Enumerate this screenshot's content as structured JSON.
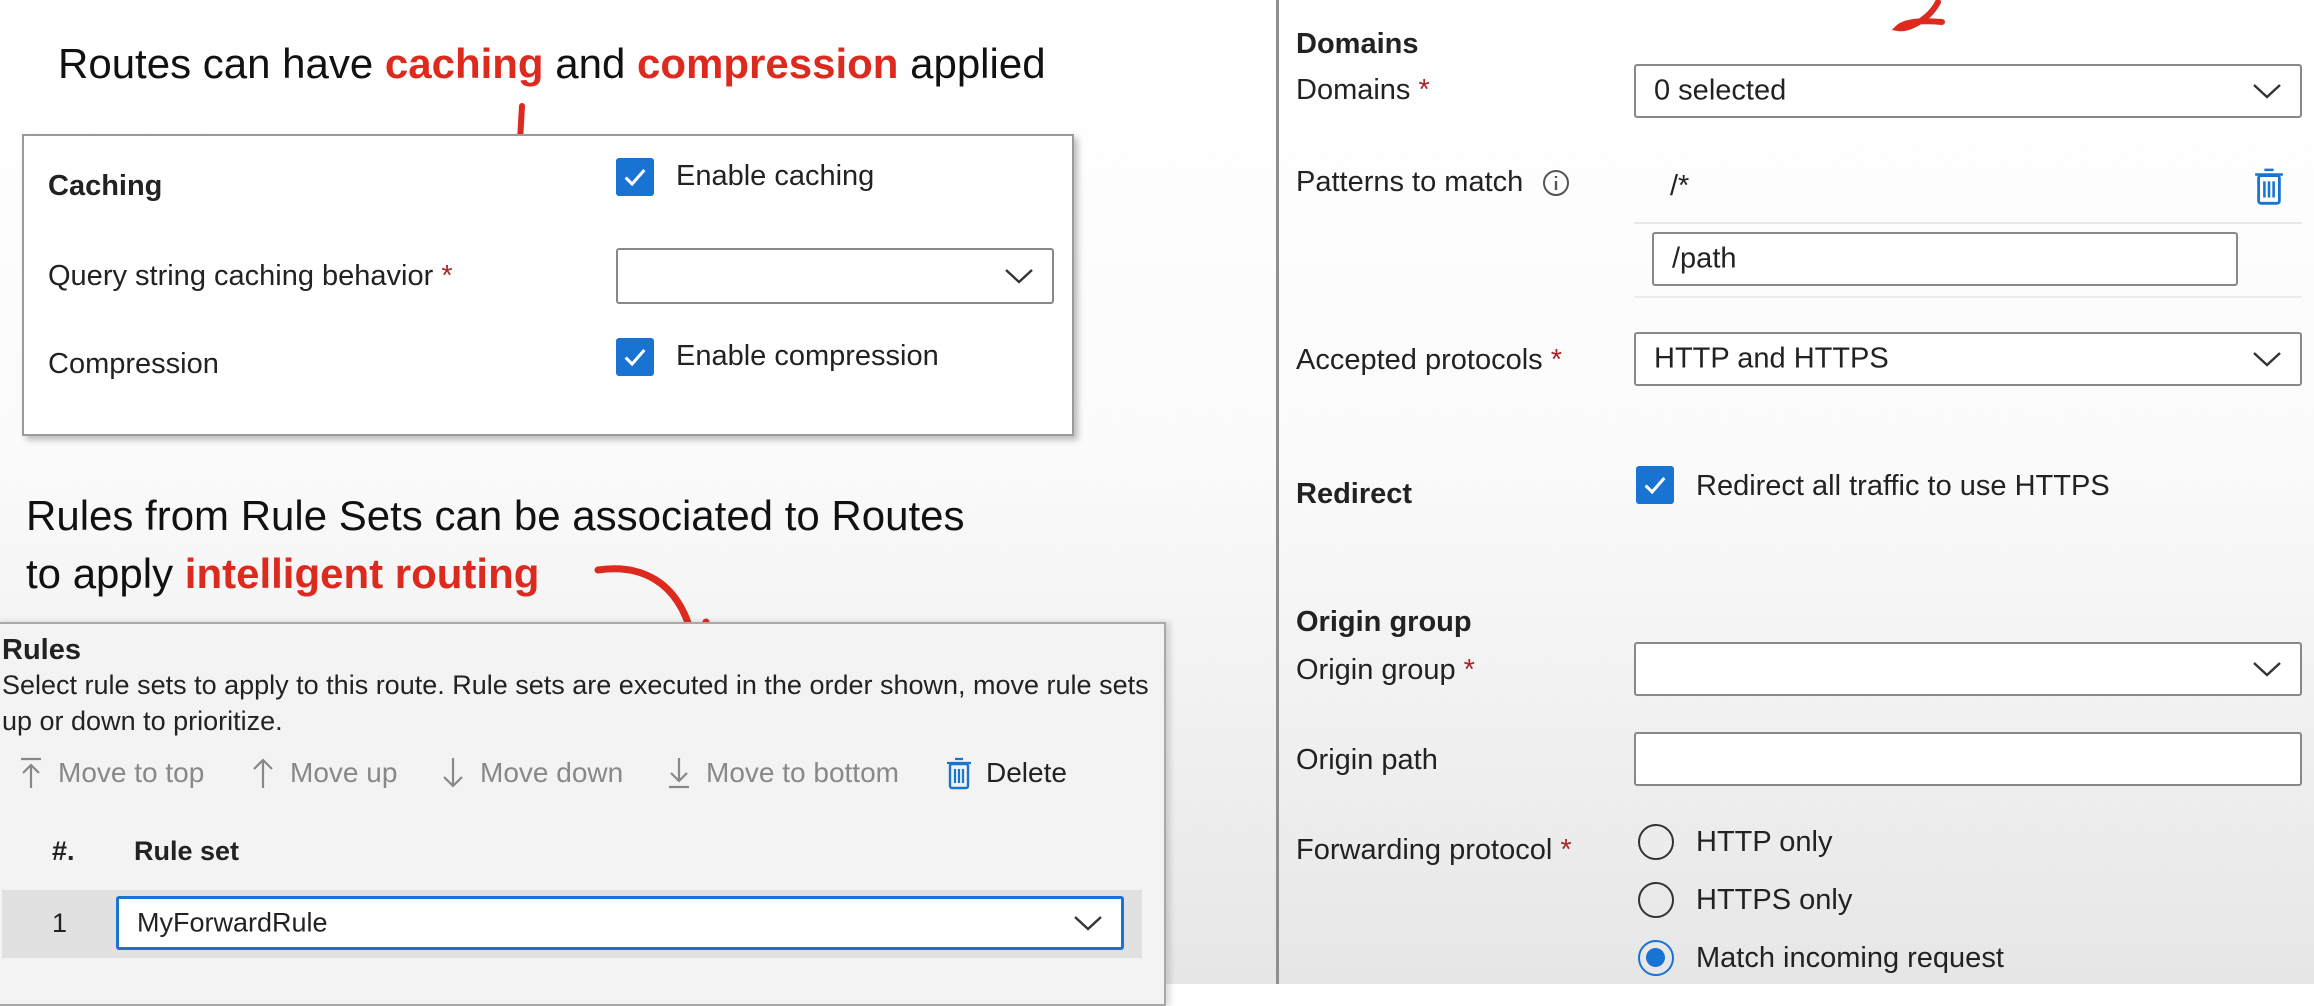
{
  "slide": {
    "heading1": {
      "prefix": "Routes can have ",
      "word1": "caching",
      "middle": " and ",
      "word2": "compression",
      "suffix": " applied"
    },
    "heading2": {
      "line1": "Rules from Rule Sets can be associated to Routes",
      "line2_prefix": "to apply ",
      "line2_highlight": "intelligent routing"
    }
  },
  "caching_panel": {
    "section_title": "Caching",
    "enable_caching": {
      "label": "Enable caching",
      "checked": true
    },
    "query_string": {
      "label": "Query string caching behavior",
      "required_mark": "*",
      "value": ""
    },
    "compression": {
      "label": "Compression",
      "checkbox_label": "Enable compression",
      "checked": true
    }
  },
  "rules_panel": {
    "title": "Rules",
    "description_line1": "Select rule sets to apply to this route. Rule sets are executed in the order shown, move rule sets",
    "description_line2": "up or down to prioritize.",
    "toolbar": {
      "move_to_top": "Move to top",
      "move_up": "Move up",
      "move_down": "Move down",
      "move_to_bottom": "Move to bottom",
      "delete": "Delete"
    },
    "columns": {
      "num": "#.",
      "rule_set": "Rule set"
    },
    "rows": [
      {
        "num": "1",
        "rule_set": "MyForwardRule"
      }
    ]
  },
  "route_form": {
    "domains_section": "Domains",
    "domains": {
      "label": "Domains",
      "required_mark": "*",
      "value": "0 selected"
    },
    "patterns": {
      "label": "Patterns to match",
      "existing": "/*",
      "input_value": "/path"
    },
    "protocols": {
      "label": "Accepted protocols",
      "required_mark": "*",
      "value": "HTTP and HTTPS"
    },
    "redirect": {
      "label": "Redirect",
      "checkbox_label": "Redirect all traffic to use HTTPS",
      "checked": true
    },
    "origin_section": "Origin group",
    "origin_group": {
      "label": "Origin group",
      "required_mark": "*",
      "value": ""
    },
    "origin_path": {
      "label": "Origin path",
      "value": ""
    },
    "forwarding": {
      "label": "Forwarding protocol",
      "required_mark": "*",
      "options": [
        "HTTP only",
        "HTTPS only",
        "Match incoming request"
      ],
      "selected": "Match incoming request"
    }
  },
  "colors": {
    "accent": "#1873d3",
    "highlight": "#dd2a1f",
    "required": "#a4262c"
  }
}
